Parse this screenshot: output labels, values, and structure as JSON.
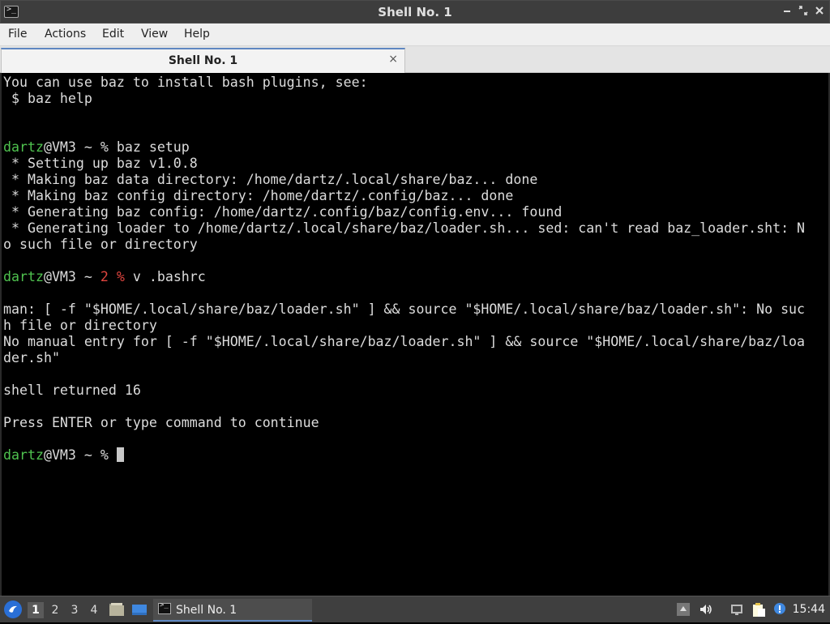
{
  "window": {
    "title": "Shell No. 1",
    "app_icon_glyph": ">_"
  },
  "menu": [
    "File",
    "Actions",
    "Edit",
    "View",
    "Help"
  ],
  "tab": {
    "label": "Shell No. 1",
    "close_glyph": "×"
  },
  "terminal": {
    "lines": [
      [
        {
          "t": "You can use baz to install bash plugins, see:",
          "c": ""
        }
      ],
      [
        {
          "t": " $ baz help",
          "c": ""
        }
      ],
      [],
      [],
      [
        {
          "t": "dartz",
          "c": "green"
        },
        {
          "t": "@VM3 ~ % baz setup",
          "c": ""
        }
      ],
      [
        {
          "t": " * Setting up baz v1.0.8",
          "c": ""
        }
      ],
      [
        {
          "t": " * Making baz data directory: /home/dartz/.local/share/baz... done",
          "c": ""
        }
      ],
      [
        {
          "t": " * Making baz config directory: /home/dartz/.config/baz... done",
          "c": ""
        }
      ],
      [
        {
          "t": " * Generating baz config: /home/dartz/.config/baz/config.env... found",
          "c": ""
        }
      ],
      [
        {
          "t": " * Generating loader to /home/dartz/.local/share/baz/loader.sh... sed: can't read baz_loader.sht: N",
          "c": ""
        }
      ],
      [
        {
          "t": "o such file or directory",
          "c": ""
        }
      ],
      [],
      [
        {
          "t": "dartz",
          "c": "green"
        },
        {
          "t": "@VM3 ~ ",
          "c": ""
        },
        {
          "t": "2 %",
          "c": "red"
        },
        {
          "t": " v .bashrc",
          "c": ""
        }
      ],
      [],
      [
        {
          "t": "man: [ -f \"$HOME/.local/share/baz/loader.sh\" ] && source \"$HOME/.local/share/baz/loader.sh\": No suc",
          "c": ""
        }
      ],
      [
        {
          "t": "h file or directory",
          "c": ""
        }
      ],
      [
        {
          "t": "No manual entry for [ -f \"$HOME/.local/share/baz/loader.sh\" ] && source \"$HOME/.local/share/baz/loa",
          "c": ""
        }
      ],
      [
        {
          "t": "der.sh\"",
          "c": ""
        }
      ],
      [],
      [
        {
          "t": "shell returned 16",
          "c": ""
        }
      ],
      [],
      [
        {
          "t": "Press ENTER or type command to continue",
          "c": ""
        }
      ],
      [],
      [
        {
          "t": "dartz",
          "c": "green"
        },
        {
          "t": "@VM3 ~ % ",
          "c": ""
        },
        {
          "t": "",
          "c": "cursor"
        }
      ]
    ]
  },
  "taskbar": {
    "workspaces": [
      "1",
      "2",
      "3",
      "4"
    ],
    "active_workspace": "1",
    "task_label": "Shell No. 1",
    "clock": "15:44",
    "accent": "#5e87c1"
  }
}
